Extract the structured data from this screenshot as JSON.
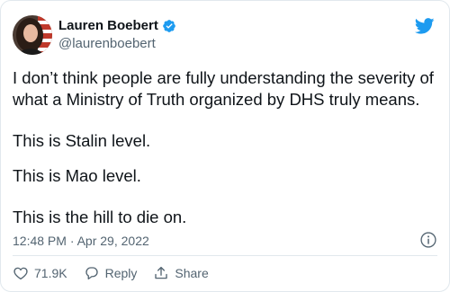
{
  "author": {
    "name": "Lauren Boebert",
    "handle": "@laurenboebert"
  },
  "tweet": {
    "paragraphs": [
      "I don’t think people are fully understanding the severity of what a Ministry of Truth organized by DHS truly means.",
      "This is Stalin level.",
      "This is Mao level.",
      "This is the hill to die on."
    ],
    "timestamp": "12:48 PM · Apr 29, 2022"
  },
  "actions": {
    "likes": "71.9K",
    "reply_label": "Reply",
    "share_label": "Share"
  },
  "colors": {
    "twitter_blue": "#1d9bf0",
    "like_red": "#f91880",
    "secondary_text": "#536471"
  },
  "icons": [
    "twitter-bird-icon",
    "verified-badge-icon",
    "info-icon",
    "heart-icon",
    "reply-icon",
    "share-icon"
  ]
}
